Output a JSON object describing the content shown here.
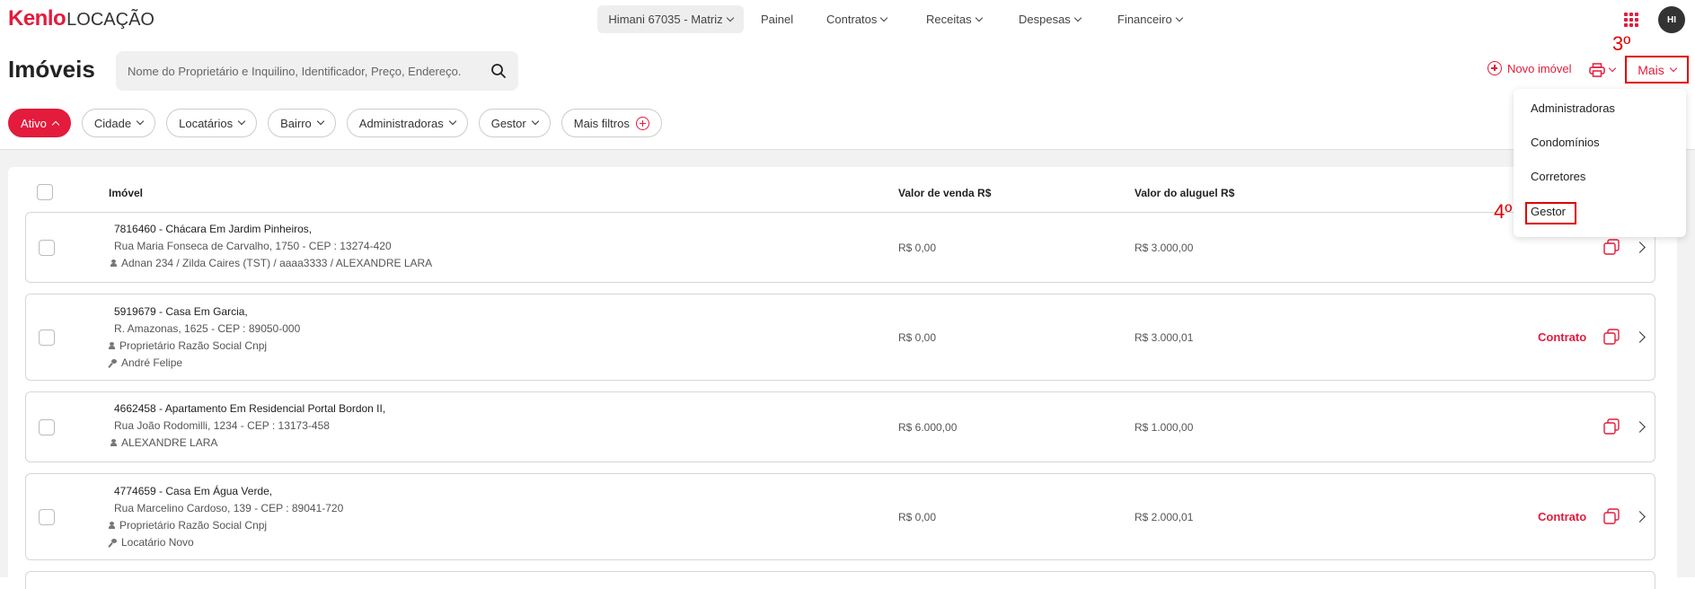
{
  "brand": {
    "name": "Kenlo",
    "product": "LOCAÇÃO"
  },
  "topnav": {
    "branch": "Himani 67035 - Matriz",
    "items": [
      "Painel",
      "Contratos",
      "Receitas",
      "Despesas",
      "Financeiro"
    ],
    "avatar": "HI"
  },
  "page": {
    "title": "Imóveis",
    "search_placeholder": "Nome do Proprietário e Inquilino, Identificador, Preço, Endereço.",
    "novo_imovel": "Novo imóvel",
    "mais": "Mais"
  },
  "annotations": {
    "step3": "3º",
    "step4": "4º"
  },
  "filters": [
    "Ativo",
    "Cidade",
    "Locatários",
    "Bairro",
    "Administradoras",
    "Gestor",
    "Mais filtros"
  ],
  "table": {
    "headers": {
      "imovel": "Imóvel",
      "venda": "Valor de venda",
      "venda_unit": "R$",
      "aluguel": "Valor do aluguel",
      "aluguel_unit": "R$"
    },
    "rows": [
      {
        "title": "7816460 - Chácara Em Jardim Pinheiros,",
        "address": "Rua Maria Fonseca de Carvalho, 1750 - CEP : 13274-420",
        "owner": "Adnan 234 / Zilda Caires (TST) / aaaa3333 / ALEXANDRE LARA",
        "tenant": "",
        "venda": "R$ 0,00",
        "aluguel": "R$ 3.000,00",
        "contrato": ""
      },
      {
        "title": "5919679 - Casa Em Garcia,",
        "address": "R. Amazonas, 1625 - CEP : 89050-000",
        "owner": "Proprietário Razão Social Cnpj",
        "tenant": "André Felipe",
        "venda": "R$ 0,00",
        "aluguel": "R$ 3.000,01",
        "contrato": "Contrato"
      },
      {
        "title": "4662458 - Apartamento Em Residencial Portal Bordon II,",
        "address": "Rua João Rodomilli, 1234 - CEP : 13173-458",
        "owner": "ALEXANDRE LARA",
        "tenant": "",
        "venda": "R$ 6.000,00",
        "aluguel": "R$ 1.000,00",
        "contrato": ""
      },
      {
        "title": "4774659 - Casa Em Água Verde,",
        "address": "Rua Marcelino Cardoso, 139 - CEP : 89041-720",
        "owner": "Proprietário Razão Social Cnpj",
        "tenant": "Locatário Novo",
        "venda": "R$ 0,00",
        "aluguel": "R$ 2.000,01",
        "contrato": "Contrato"
      }
    ]
  },
  "dropdown": {
    "items": [
      "Administradoras",
      "Condomínios",
      "Corretores",
      "Gestor"
    ]
  },
  "colors": {
    "accent": "#e31b3c",
    "annotation": "#e00000"
  }
}
